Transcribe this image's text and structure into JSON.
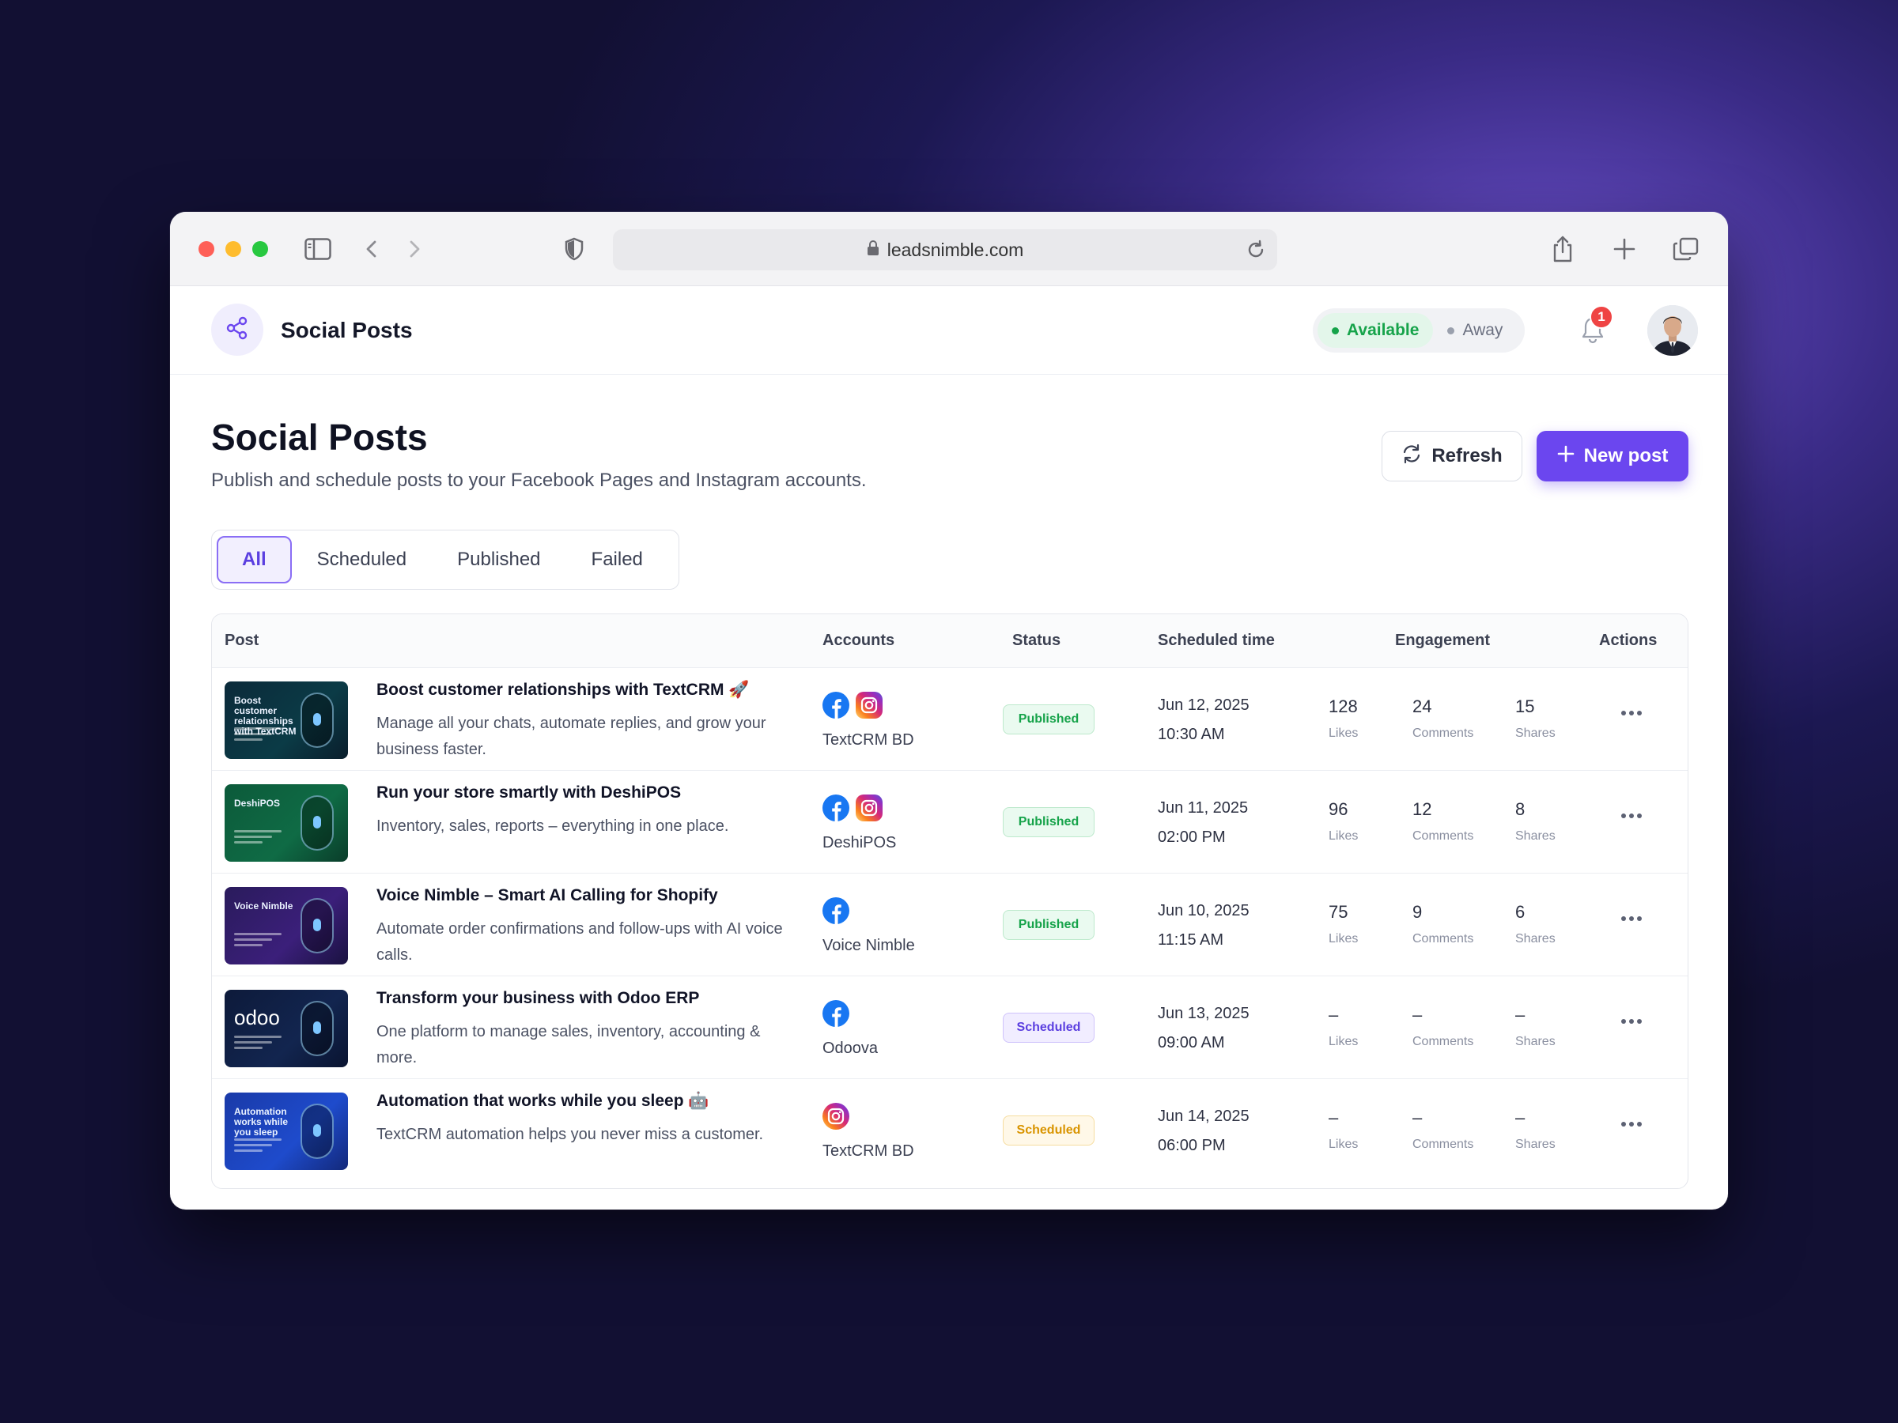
{
  "browser": {
    "url": "leadsnimble.com"
  },
  "header": {
    "app_title": "Social Posts",
    "status_available": "Available",
    "status_away": "Away",
    "notification_count": "1"
  },
  "page": {
    "title": "Social Posts",
    "subtitle": "Publish and schedule posts to your Facebook Pages and Instagram accounts.",
    "refresh_label": "Refresh",
    "new_post_label": "New post"
  },
  "tabs": [
    {
      "label": "All"
    },
    {
      "label": "Scheduled"
    },
    {
      "label": "Published"
    },
    {
      "label": "Failed"
    }
  ],
  "table": {
    "columns": [
      "Post",
      "Accounts",
      "Status",
      "Scheduled time",
      "Engagement",
      "Actions"
    ],
    "engagement_labels": {
      "likes": "Likes",
      "comments": "Comments",
      "shares": "Shares"
    },
    "rows": [
      {
        "title": "Boost customer relationships with TextCRM 🚀",
        "description": "Manage all your chats, automate replies, and grow your business faster.",
        "thumb_text": "Boost customer relationships with TextCRM",
        "accounts": [
          "facebook",
          "instagram"
        ],
        "account_name": "TextCRM BD",
        "status": "Published",
        "date": "Jun 12, 2025",
        "time": "10:30 AM",
        "likes": "128",
        "comments": "24",
        "shares": "15"
      },
      {
        "title": "Run your store smartly with DeshiPOS",
        "description": "Inventory, sales, reports – everything in one place.",
        "thumb_text": "DeshiPOS",
        "accounts": [
          "facebook",
          "instagram"
        ],
        "account_name": "DeshiPOS",
        "status": "Published",
        "date": "Jun 11, 2025",
        "time": "02:00 PM",
        "likes": "96",
        "comments": "12",
        "shares": "8"
      },
      {
        "title": "Voice Nimble – Smart AI Calling for Shopify",
        "description": "Automate order confirmations and follow-ups with AI voice calls.",
        "thumb_text": "Voice Nimble",
        "accounts": [
          "facebook"
        ],
        "account_name": "Voice Nimble",
        "status": "Published",
        "date": "Jun 10, 2025",
        "time": "11:15 AM",
        "likes": "75",
        "comments": "9",
        "shares": "6"
      },
      {
        "title": "Transform your business with Odoo ERP",
        "description": "One platform to manage sales, inventory, accounting & more.",
        "thumb_text": "odoo",
        "accounts": [
          "facebook"
        ],
        "account_name": "Odoova",
        "status": "Scheduled",
        "date": "Jun 13, 2025",
        "time": "09:00 AM",
        "likes": "–",
        "comments": "–",
        "shares": "–"
      },
      {
        "title": "Automation that works while you sleep 🤖",
        "description": "TextCRM automation helps you never miss a customer.",
        "thumb_text": "Automation works while you sleep",
        "accounts": [
          "instagram"
        ],
        "account_name": "TextCRM BD",
        "status": "Scheduled",
        "date": "Jun 14, 2025",
        "time": "06:00 PM",
        "likes": "–",
        "comments": "–",
        "shares": "–"
      }
    ]
  },
  "colors": {
    "accent": "#6b46ef",
    "published": "#16a34a",
    "scheduled": "#5b3fe0",
    "scheduled_warn": "#d99400",
    "facebook": "#1877f2"
  },
  "icons": [
    "share-icon",
    "bell-icon",
    "refresh-icon",
    "plus-icon",
    "more-icon",
    "facebook-icon",
    "instagram-icon",
    "lock-icon",
    "shield-icon",
    "sidebar-icon",
    "share-out-icon",
    "tabs-icon"
  ]
}
